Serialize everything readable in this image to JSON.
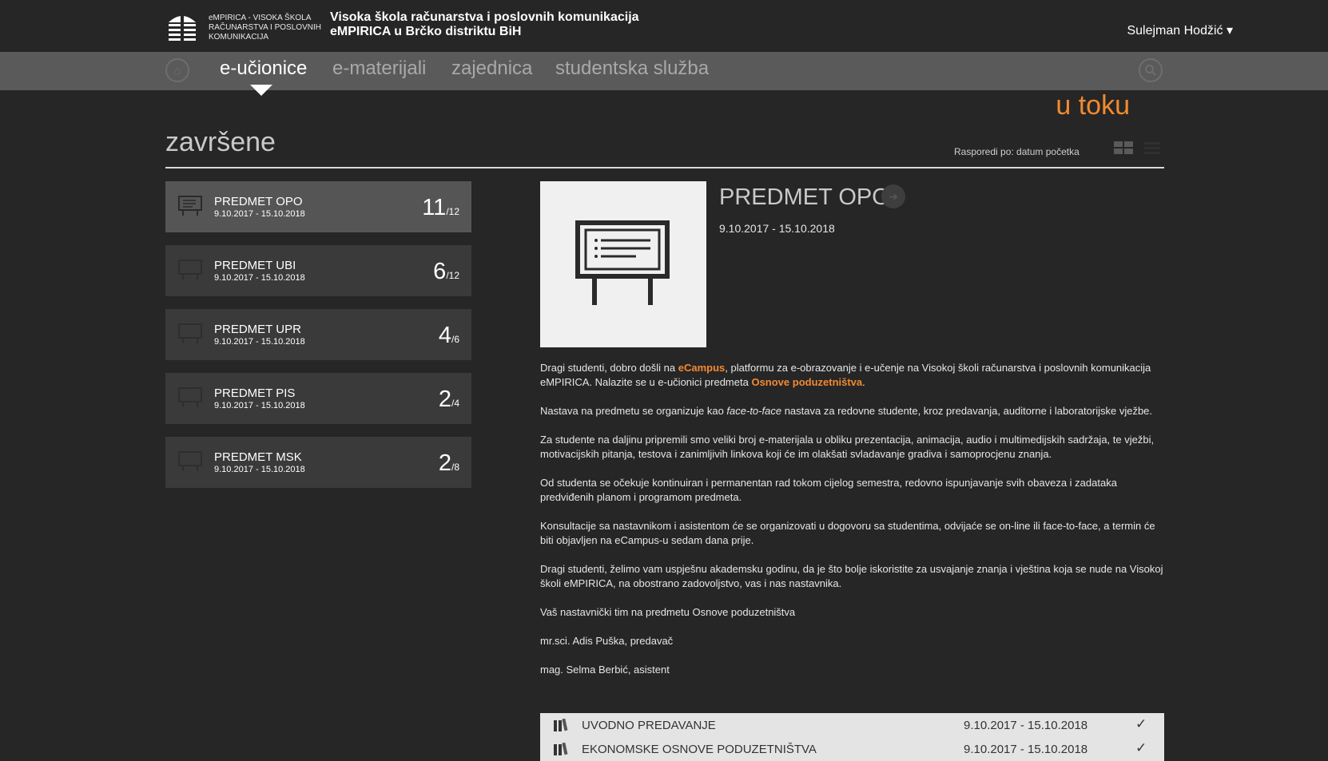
{
  "header": {
    "logo_text_line1": "eMPIRICA  -  VISOKA ŠKOLA",
    "logo_text_line2": "RAČUNARSTVA I POSLOVNIH",
    "logo_text_line3": "KOMUNIKACIJA",
    "institution_line1": "Visoka škola računarstva i poslovnih komunikacija",
    "institution_line2": "eMPIRICA u Brčko distriktu BiH",
    "user_name": "Sulejman Hodžić ▾"
  },
  "nav": {
    "home_icon": "home-icon",
    "search_icon": "search-icon",
    "links": [
      {
        "label": "e-učionice",
        "active": true
      },
      {
        "label": "e-materijali",
        "active": false
      },
      {
        "label": "zajednica",
        "active": false
      },
      {
        "label": "studentska služba",
        "active": false
      }
    ]
  },
  "filters": {
    "in_progress": "u toku",
    "completed_title": "završene",
    "sort_label": "Rasporedi po: datum početka"
  },
  "courses": [
    {
      "name": "PREDMET OPO",
      "dates": "9.10.2017 - 15.10.2018",
      "done": "11",
      "total": "/12",
      "active": true
    },
    {
      "name": "PREDMET UBI",
      "dates": "9.10.2017 - 15.10.2018",
      "done": "6",
      "total": "/12",
      "active": false
    },
    {
      "name": "PREDMET UPR",
      "dates": "9.10.2017 - 15.10.2018",
      "done": "4",
      "total": "/6",
      "active": false
    },
    {
      "name": "PREDMET PIS",
      "dates": "9.10.2017 - 15.10.2018",
      "done": "2",
      "total": "/4",
      "active": false
    },
    {
      "name": "PREDMET MSK",
      "dates": "9.10.2017 - 15.10.2018",
      "done": "2",
      "total": "/8",
      "active": false
    }
  ],
  "detail": {
    "title": "PREDMET OPO",
    "dates": "9.10.2017 - 15.10.2018",
    "p1_a": "Dragi studenti, dobro došli na ",
    "p1_b": "eCampus",
    "p1_c": ", platformu za e-obrazovanje i e-učenje na Visokoj školi računarstva i poslovnih komunikacija eMPIRICA. Nalazite se u e-učionici predmeta ",
    "p1_d": "Osnove poduzetništva",
    "p1_e": ".",
    "p2_a": "Nastava na predmetu se organizuje kao ",
    "p2_b": "face-to-face",
    "p2_c": " nastava za redovne studente, kroz predavanja, auditorne i laboratorijske vježbe.",
    "p3": "Za studente na daljinu pripremili smo veliki broj e-materijala u obliku prezentacija, animacija, audio i multimedijskih sadržaja, te vježbi, motivacijskih pitanja, testova i zanimljivih linkova koji će im olakšati svladavanje gradiva i samoprocjenu znanja.",
    "p4": "Od studenta se očekuje kontinuiran i permanentan rad tokom cijelog semestra, redovno ispunjavanje svih obaveza i zadataka predviđenih planom i programom predmeta.",
    "p5": "Konsultacije sa nastavnikom i asistentom će se organizovati u dogovoru sa studentima, odvijaće se on-line ili face-to-face, a termin će biti objavljen na eCampus-u sedam dana prije.",
    "p6": "Dragi studenti, želimo vam uspješnu akademsku godinu, da je što bolje iskoristite za usvajanje znanja i vještina koja se nude na Visokoj školi eMPIRICA, na obostrano zadovoljstvo, vas i nas nastavnika.",
    "p7": "Vaš nastavnički tim na predmetu Osnove poduzetništva",
    "p8": "mr.sci. Adis Puška, predavač",
    "p9": "mag. Selma Berbić, asistent"
  },
  "lectures": [
    {
      "title": "UVODNO PREDAVANJE",
      "dates": "9.10.2017 - 15.10.2018",
      "check": "✓"
    },
    {
      "title": "EKONOMSKE OSNOVE PODUZETNIŠTVA",
      "dates": "9.10.2017 - 15.10.2018",
      "check": "✓"
    }
  ],
  "colors": {
    "accent": "#f28a30",
    "background": "#262626",
    "navbar": "#5a5a5a",
    "card": "#3a3a3a",
    "card_active": "#555555"
  }
}
